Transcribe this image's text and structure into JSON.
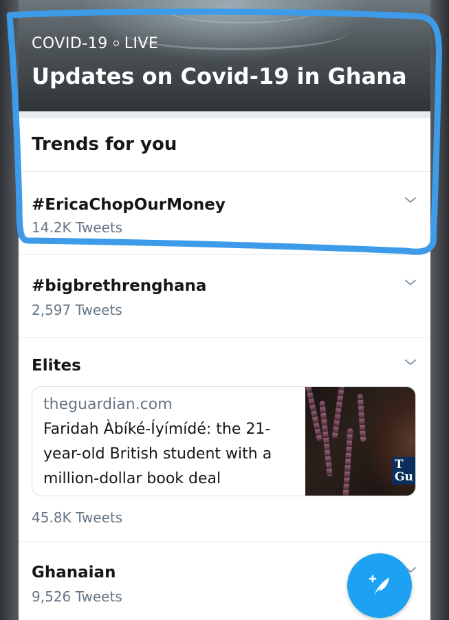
{
  "hero": {
    "category": "COVID-19",
    "status": "LIVE",
    "title": "Updates on Covid-19 in Ghana"
  },
  "section": {
    "title": "Trends for you"
  },
  "trends": [
    {
      "name": "#EricaChopOurMoney",
      "count": "14.2K Tweets"
    },
    {
      "name": "#bigbrethrenghana",
      "count": "2,597 Tweets"
    },
    {
      "name": "Elites",
      "count": "45.8K Tweets",
      "news": {
        "domain": "theguardian.com",
        "headline": "Faridah Àbíké-Íyímídé: the 21-year-old British student with a million-dollar book deal",
        "thumb_mark": "T Gu"
      }
    },
    {
      "name": "Ghanaian",
      "count": "9,526 Tweets"
    }
  ],
  "colors": {
    "accent": "#1da1f2",
    "highlight_stroke": "#3d9be9",
    "text_primary": "#14171a",
    "text_secondary": "#657786",
    "divider": "#e6ecf0"
  },
  "icons": {
    "more": "chevron-down-icon",
    "compose": "compose-tweet-icon"
  }
}
